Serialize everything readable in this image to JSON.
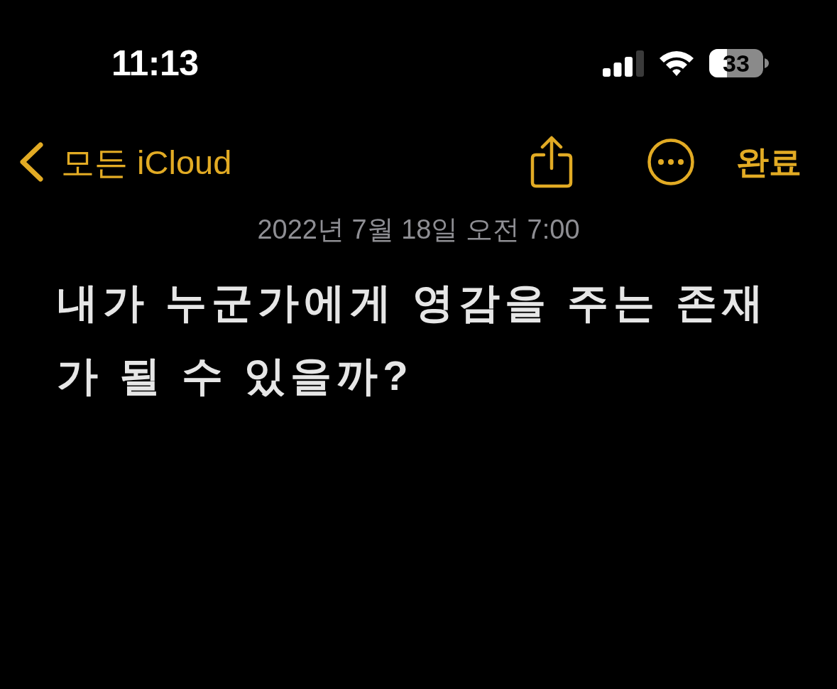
{
  "status_bar": {
    "time": "11:13",
    "battery": {
      "reading": "33",
      "level": 0.33
    }
  },
  "nav_bar": {
    "back_label": "모든 iCloud",
    "done_label": "완료"
  },
  "note": {
    "date": "2022년 7월 18일 오전 7:00",
    "title": "내가 누군가에게 영감을 주는 존재가 될 수 있을까?"
  }
}
